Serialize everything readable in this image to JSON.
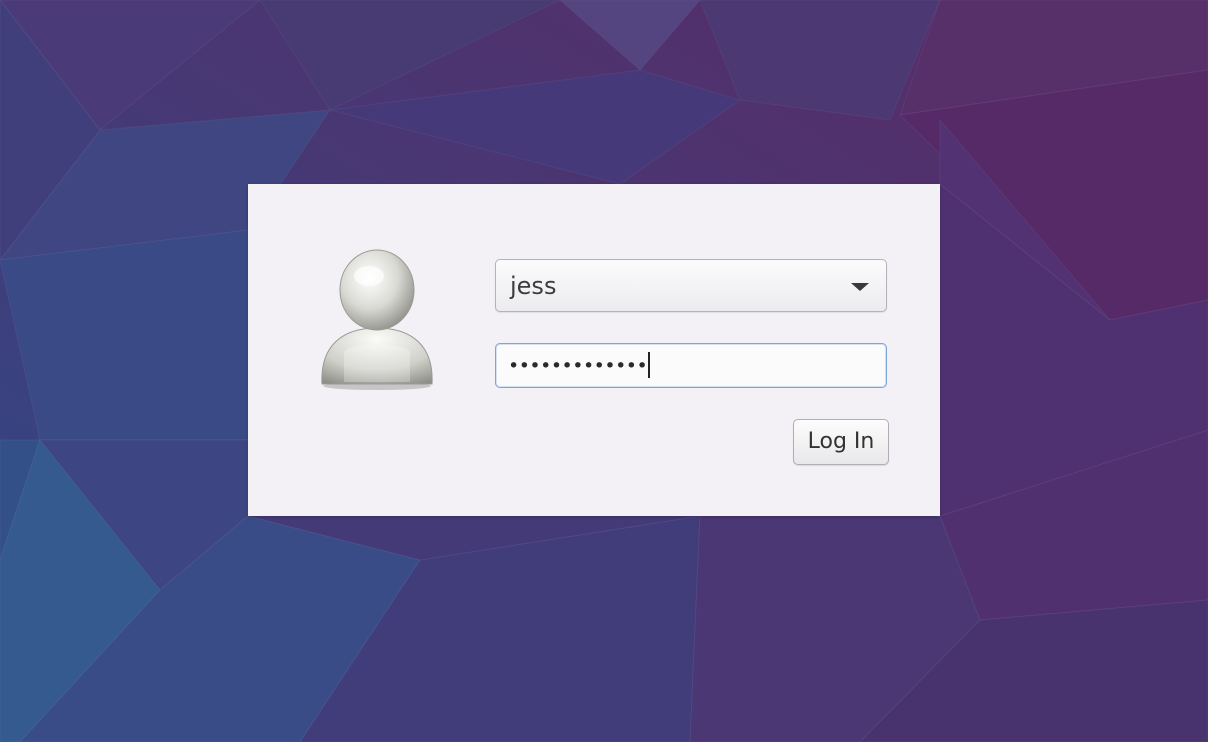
{
  "login": {
    "username": "jess",
    "password_masked": "•••••••••••••",
    "login_button_label": "Log In"
  },
  "icons": {
    "avatar": "user-avatar-icon",
    "dropdown": "chevron-down-icon"
  },
  "colors": {
    "desktop_background": "#4a3a74",
    "panel_background": "#f3f1f5",
    "focus_border": "#7fa4da"
  }
}
